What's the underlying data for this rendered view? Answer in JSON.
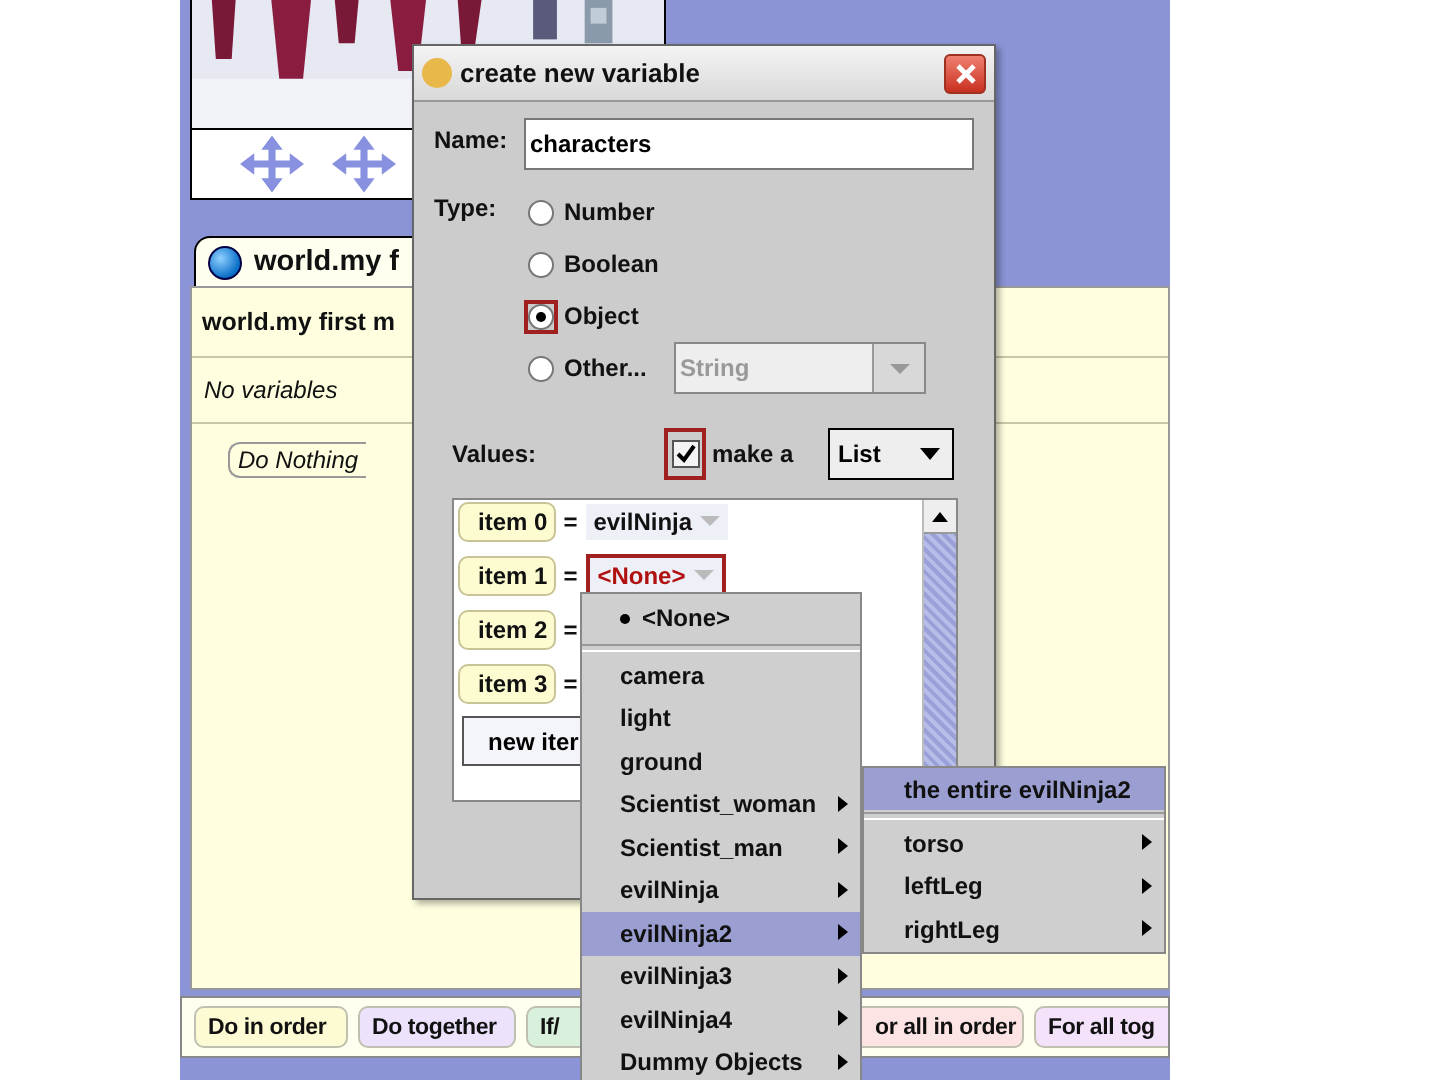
{
  "editor": {
    "tab": "world.my f",
    "method_title": "world.my first m",
    "variables_note": "No variables",
    "statement": "Do Nothing"
  },
  "palette": [
    {
      "label": "Do in order",
      "color": "#fdfbd4"
    },
    {
      "label": "Do together",
      "color": "#ece2fb"
    },
    {
      "label": "If/",
      "color": "#d9f0dc"
    },
    {
      "label": "or all in order",
      "color": "#fde4e4"
    },
    {
      "label": "For all tog",
      "color": "#f3e2fa"
    }
  ],
  "dialog": {
    "title": "create new variable",
    "name_label": "Name:",
    "name_value": "characters",
    "type_label": "Type:",
    "types": [
      {
        "label": "Number",
        "selected": false,
        "highlighted": false
      },
      {
        "label": "Boolean",
        "selected": false,
        "highlighted": false
      },
      {
        "label": "Object",
        "selected": true,
        "highlighted": true
      },
      {
        "label": "Other...",
        "selected": false,
        "highlighted": false
      }
    ],
    "other_type": {
      "value": "String",
      "disabled": true
    },
    "values_label": "Values:",
    "make_list": {
      "label": "make a",
      "checked": true,
      "highlighted": true
    },
    "collection": "List",
    "items": [
      {
        "label": "item 0",
        "eq": "=",
        "value": "evilNinja",
        "kind": "object",
        "highlighted": false
      },
      {
        "label": "item 1",
        "eq": "=",
        "value": "<None>",
        "kind": "none",
        "highlighted": true
      },
      {
        "label": "item 2",
        "eq": "=",
        "kind": "hidden"
      },
      {
        "label": "item 3",
        "eq": "=",
        "kind": "hidden"
      }
    ],
    "new_item_button": "new iter"
  },
  "menu": {
    "items": [
      {
        "label": "<None>",
        "kind": "current",
        "submenu": false,
        "selected": false
      },
      {
        "label": "camera",
        "kind": "object",
        "submenu": false,
        "selected": false
      },
      {
        "label": "light",
        "kind": "object",
        "submenu": false,
        "selected": false
      },
      {
        "label": "ground",
        "kind": "object",
        "submenu": false,
        "selected": false
      },
      {
        "label": "Scientist_woman",
        "kind": "object",
        "submenu": true,
        "selected": false
      },
      {
        "label": "Scientist_man",
        "kind": "object",
        "submenu": true,
        "selected": false
      },
      {
        "label": "evilNinja",
        "kind": "object",
        "submenu": true,
        "selected": false
      },
      {
        "label": "evilNinja2",
        "kind": "object",
        "submenu": true,
        "selected": true
      },
      {
        "label": "evilNinja3",
        "kind": "object",
        "submenu": true,
        "selected": false
      },
      {
        "label": "evilNinja4",
        "kind": "object",
        "submenu": true,
        "selected": false
      },
      {
        "label": "Dummy Objects",
        "kind": "object",
        "submenu": true,
        "selected": false
      }
    ]
  },
  "submenu": {
    "items": [
      {
        "label": "the entire evilNinja2",
        "kind": "whole",
        "submenu": false,
        "selected": true
      },
      {
        "label": "torso",
        "kind": "part",
        "submenu": true,
        "selected": false
      },
      {
        "label": "leftLeg",
        "kind": "part",
        "submenu": true,
        "selected": false
      },
      {
        "label": "rightLeg",
        "kind": "part",
        "submenu": true,
        "selected": false
      }
    ]
  }
}
